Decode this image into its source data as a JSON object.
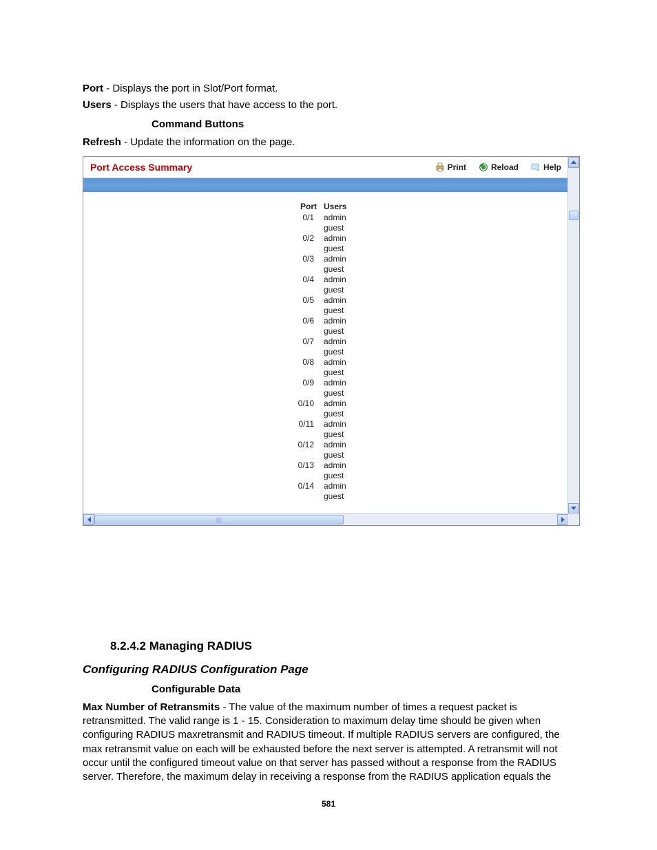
{
  "doc": {
    "defs": [
      {
        "term": "Port",
        "desc": " - Displays the port in Slot/Port format."
      },
      {
        "term": "Users",
        "desc": " - Displays the users that have access to the port."
      }
    ],
    "cmd_buttons_heading": "Command Buttons",
    "refresh": {
      "term": "Refresh",
      "desc": " - Update the information on the page."
    },
    "sec_num_heading": "8.2.4.2 Managing RADIUS",
    "italic_heading": "Configuring RADIUS Configuration Page",
    "configurable_data_heading": "Configurable Data",
    "retransmits": {
      "term": "Max Number of Retransmits",
      "desc": " - The value of the maximum number of times a request packet is retransmitted. The valid range is 1 - 15. Consideration to maximum delay time should be given when configuring RADIUS maxretransmit and RADIUS timeout. If multiple RADIUS servers are configured, the max retransmit value on each will be exhausted before the next server is attempted. A retransmit will not occur until the configured timeout value on that server has passed without a response from the RADIUS server. Therefore, the maximum delay in receiving a response from the RADIUS application equals the"
    },
    "page_number": "581"
  },
  "panel": {
    "title": "Port Access Summary",
    "actions": {
      "print": "Print",
      "reload": "Reload",
      "help": "Help"
    },
    "columns": {
      "port": "Port",
      "users": "Users"
    },
    "rows": [
      {
        "port": "0/1",
        "u1": "admin",
        "u2": "guest"
      },
      {
        "port": "0/2",
        "u1": "admin",
        "u2": "guest"
      },
      {
        "port": "0/3",
        "u1": "admin",
        "u2": "guest"
      },
      {
        "port": "0/4",
        "u1": "admin",
        "u2": "guest"
      },
      {
        "port": "0/5",
        "u1": "admin",
        "u2": "guest"
      },
      {
        "port": "0/6",
        "u1": "admin",
        "u2": "guest"
      },
      {
        "port": "0/7",
        "u1": "admin",
        "u2": "guest"
      },
      {
        "port": "0/8",
        "u1": "admin",
        "u2": "guest"
      },
      {
        "port": "0/9",
        "u1": "admin",
        "u2": "guest"
      },
      {
        "port": "0/10",
        "u1": "admin",
        "u2": "guest"
      },
      {
        "port": "0/11",
        "u1": "admin",
        "u2": "guest"
      },
      {
        "port": "0/12",
        "u1": "admin",
        "u2": "guest"
      },
      {
        "port": "0/13",
        "u1": "admin",
        "u2": "guest"
      },
      {
        "port": "0/14",
        "u1": "admin",
        "u2": "guest"
      }
    ]
  }
}
